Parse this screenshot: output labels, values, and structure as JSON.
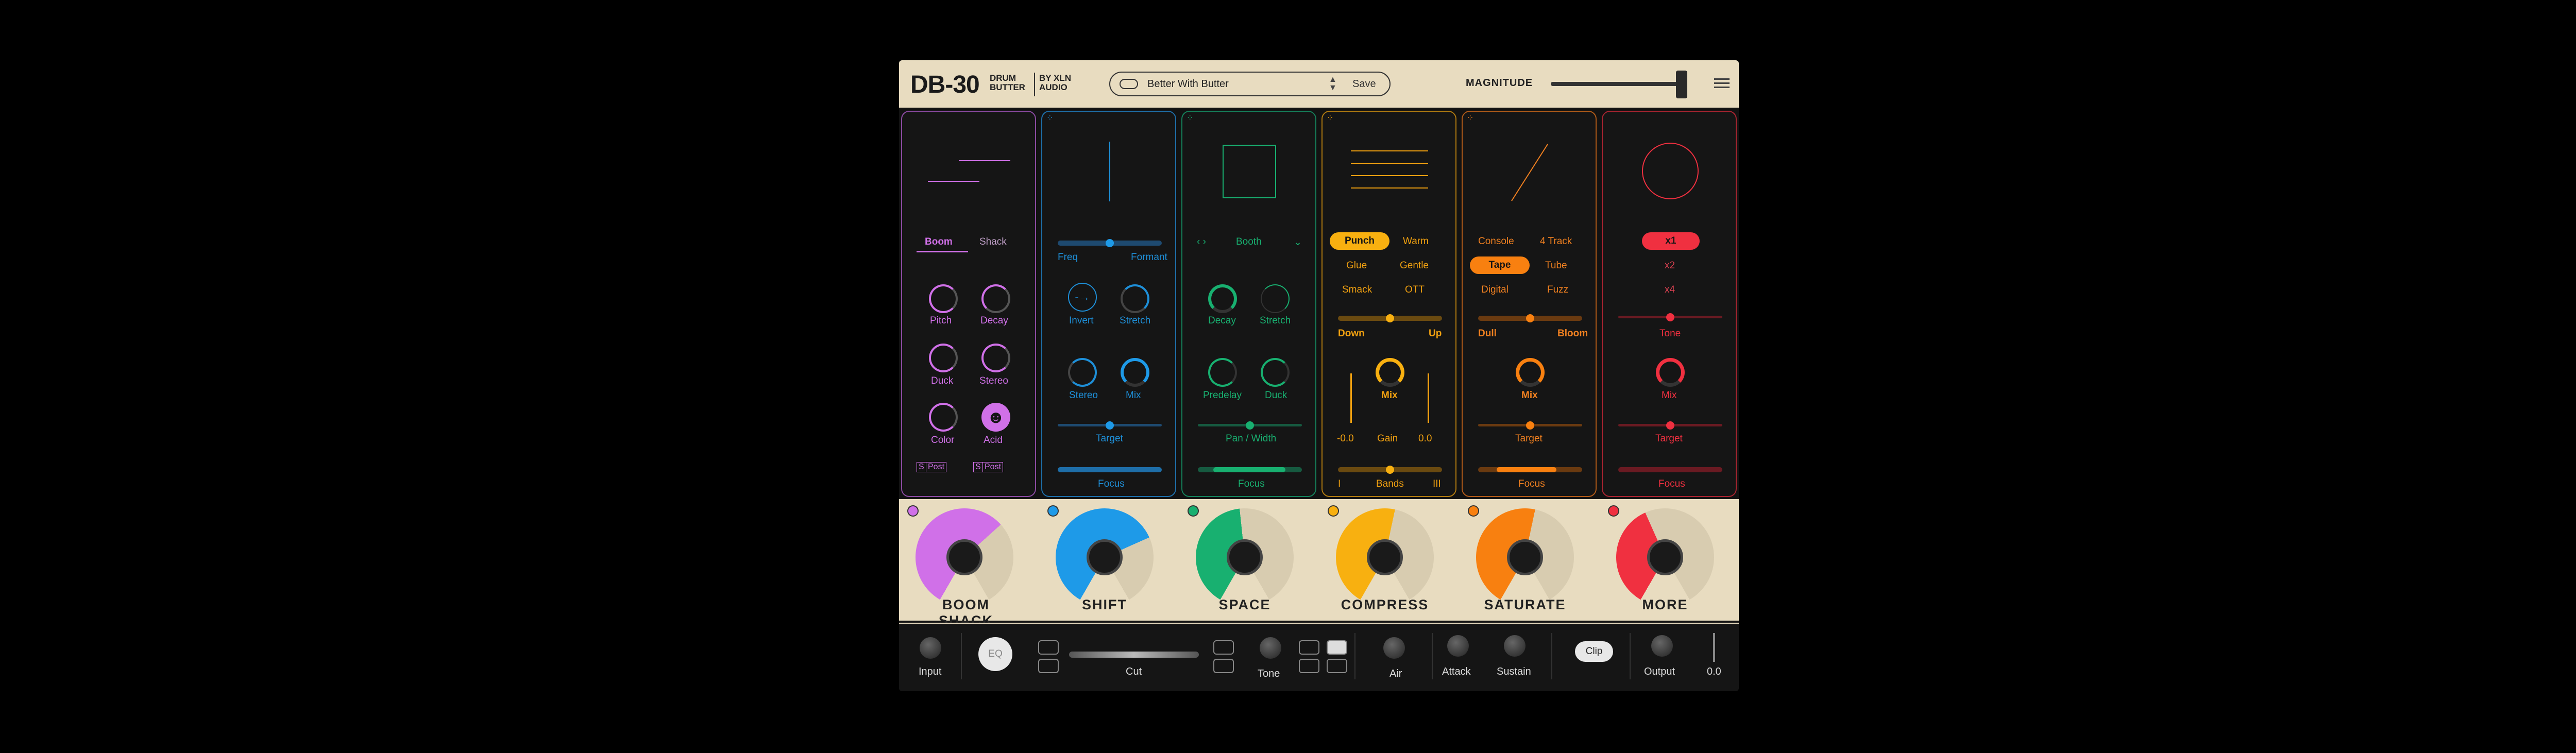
{
  "header": {
    "logo": "DB-30",
    "logo_sub_1": "DRUM",
    "logo_sub_2": "BUTTER",
    "by": "BY XLN",
    "by_2": "AUDIO",
    "preset_name": "Better With Butter",
    "save_label": "Save",
    "magnitude_label": "MAGNITUDE",
    "magnitude_value": 0.95
  },
  "boom": {
    "color": "#d070e8",
    "tabs": [
      "Boom",
      "Shack"
    ],
    "knobs": [
      "Pitch",
      "Decay",
      "Duck",
      "Stereo",
      "Color",
      "Acid"
    ],
    "chips": [
      "S",
      "Post",
      "S",
      "Post"
    ]
  },
  "shift": {
    "color": "#1e8fd8",
    "labels": [
      "Freq",
      "Formant"
    ],
    "knobs": [
      "Invert",
      "Stretch",
      "Stereo",
      "Mix"
    ],
    "target": "Target",
    "focus": "Focus"
  },
  "space": {
    "color": "#18b070",
    "room": "Booth",
    "knobs": [
      "Decay",
      "Stretch",
      "Predelay",
      "Duck"
    ],
    "pan": "Pan / Width",
    "focus": "Focus"
  },
  "compress": {
    "color": "#f0a010",
    "modes": [
      "Punch",
      "Warm",
      "Glue",
      "Gentle",
      "Smack",
      "OTT"
    ],
    "down": "Down",
    "up": "Up",
    "mix": "Mix",
    "gain_left": "-0.0",
    "gain": "Gain",
    "gain_right": "0.0",
    "bands_left": "I",
    "bands": "Bands",
    "bands_right": "III"
  },
  "saturate": {
    "color": "#f08020",
    "modes": [
      "Console",
      "4 Track",
      "Tape",
      "Tube",
      "Digital",
      "Fuzz"
    ],
    "dull": "Dull",
    "bloom": "Bloom",
    "mix": "Mix",
    "target": "Target",
    "focus": "Focus"
  },
  "more": {
    "color": "#f03040",
    "modes": [
      "x1",
      "x2",
      "x4"
    ],
    "tone": "Tone",
    "mix": "Mix",
    "target": "Target",
    "focus": "Focus"
  },
  "macros": [
    {
      "name": "BOOM  SHACK",
      "color": "#d070e8",
      "level": 0.55
    },
    {
      "name": "SHIFT",
      "color": "#1e9ae8",
      "level": 0.6
    },
    {
      "name": "SPACE",
      "color": "#18b070",
      "level": 0.4
    },
    {
      "name": "COMPRESS",
      "color": "#f8b010",
      "level": 0.45
    },
    {
      "name": "SATURATE",
      "color": "#f88010",
      "level": 0.45
    },
    {
      "name": "MORE",
      "color": "#f03040",
      "level": 0.35
    }
  ],
  "master": {
    "input": "Input",
    "eq": "EQ",
    "cut": "Cut",
    "tone": "Tone",
    "air": "Air",
    "attack": "Attack",
    "sustain": "Sustain",
    "clip": "Clip",
    "output": "Output",
    "output_value": "0.0"
  }
}
